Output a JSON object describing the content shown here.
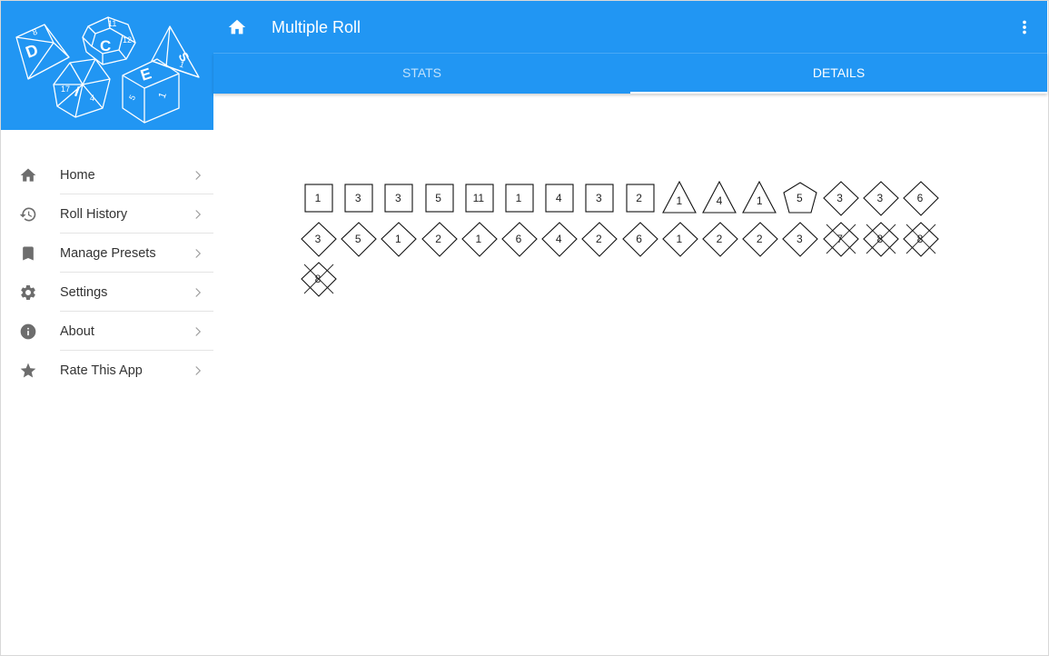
{
  "app": {
    "title": "Multiple Roll"
  },
  "header_logo": {
    "letters": [
      "D",
      "C",
      "E",
      "I",
      "S"
    ]
  },
  "tabs": [
    {
      "label": "STATS",
      "selected": false
    },
    {
      "label": "DETAILS",
      "selected": true
    }
  ],
  "nav": {
    "items": [
      {
        "label": "Home",
        "icon": "home-icon"
      },
      {
        "label": "Roll History",
        "icon": "history-icon"
      },
      {
        "label": "Manage Presets",
        "icon": "bookmark-icon"
      },
      {
        "label": "Settings",
        "icon": "gear-icon"
      },
      {
        "label": "About",
        "icon": "info-icon"
      },
      {
        "label": "Rate This App",
        "icon": "star-icon"
      }
    ]
  },
  "colors": {
    "primary": "#2196f3"
  },
  "rolls": [
    {
      "value": "1",
      "shape": "square",
      "dropped": false
    },
    {
      "value": "3",
      "shape": "square",
      "dropped": false
    },
    {
      "value": "3",
      "shape": "square",
      "dropped": false
    },
    {
      "value": "5",
      "shape": "square",
      "dropped": false
    },
    {
      "value": "11",
      "shape": "square",
      "dropped": false
    },
    {
      "value": "1",
      "shape": "square",
      "dropped": false
    },
    {
      "value": "4",
      "shape": "square",
      "dropped": false
    },
    {
      "value": "3",
      "shape": "square",
      "dropped": false
    },
    {
      "value": "2",
      "shape": "square",
      "dropped": false
    },
    {
      "value": "1",
      "shape": "triangle",
      "dropped": false
    },
    {
      "value": "4",
      "shape": "triangle",
      "dropped": false
    },
    {
      "value": "1",
      "shape": "triangle",
      "dropped": false
    },
    {
      "value": "5",
      "shape": "pentagon",
      "dropped": false
    },
    {
      "value": "3",
      "shape": "diamond",
      "dropped": false
    },
    {
      "value": "3",
      "shape": "diamond",
      "dropped": false
    },
    {
      "value": "6",
      "shape": "diamond",
      "dropped": false
    },
    {
      "value": "3",
      "shape": "diamond",
      "dropped": false
    },
    {
      "value": "5",
      "shape": "diamond",
      "dropped": false
    },
    {
      "value": "1",
      "shape": "diamond",
      "dropped": false
    },
    {
      "value": "2",
      "shape": "diamond",
      "dropped": false
    },
    {
      "value": "1",
      "shape": "diamond",
      "dropped": false
    },
    {
      "value": "6",
      "shape": "diamond",
      "dropped": false
    },
    {
      "value": "4",
      "shape": "diamond",
      "dropped": false
    },
    {
      "value": "2",
      "shape": "diamond",
      "dropped": false
    },
    {
      "value": "6",
      "shape": "diamond",
      "dropped": false
    },
    {
      "value": "1",
      "shape": "diamond",
      "dropped": false
    },
    {
      "value": "2",
      "shape": "diamond",
      "dropped": false
    },
    {
      "value": "2",
      "shape": "diamond",
      "dropped": false
    },
    {
      "value": "3",
      "shape": "diamond",
      "dropped": false
    },
    {
      "value": "7",
      "shape": "diamond",
      "dropped": true
    },
    {
      "value": "8",
      "shape": "diamond",
      "dropped": true
    },
    {
      "value": "8",
      "shape": "diamond",
      "dropped": true
    },
    {
      "value": "8",
      "shape": "diamond",
      "dropped": true
    }
  ]
}
